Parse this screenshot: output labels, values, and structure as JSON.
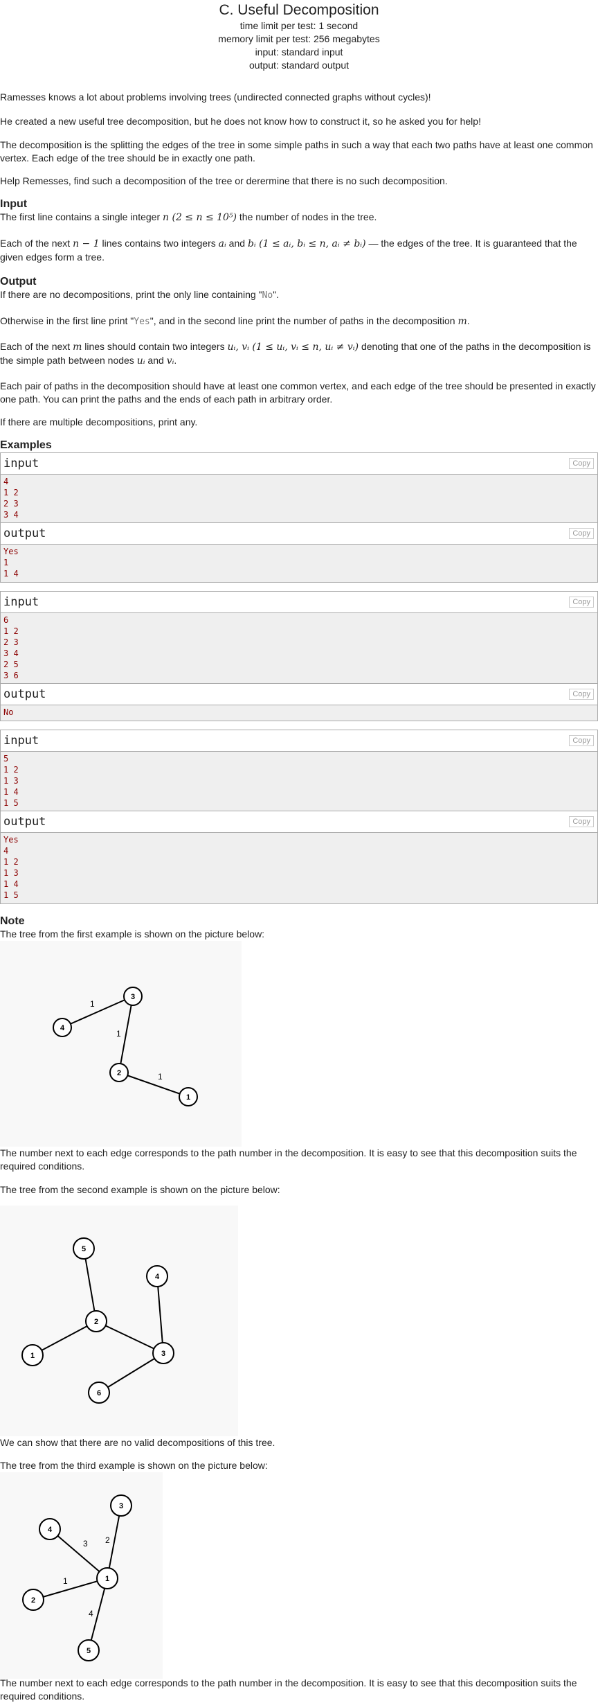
{
  "header": {
    "title": "C. Useful Decomposition",
    "time_limit": "time limit per test: 1 second",
    "memory_limit": "memory limit per test: 256 megabytes",
    "input": "input: standard input",
    "output": "output: standard output"
  },
  "legend": [
    "Ramesses knows a lot about problems involving trees (undirected connected graphs without cycles)!",
    "He created a new useful tree decomposition, but he does not know how to construct it, so he asked you for help!",
    "The decomposition is the splitting the edges of the tree in some simple paths in such a way that each two paths have at least one common vertex. Each edge of the tree should be in exactly one path.",
    "Help Remesses, find such a decomposition of the tree or derermine that there is no such decomposition."
  ],
  "input_spec": {
    "title": "Input",
    "line1_a": "The first line contains a single integer ",
    "line1_math": "n (2 ≤ n ≤ 10⁵)",
    "line1_b": " the number of nodes in the tree.",
    "line2_a": "Each of the next ",
    "line2_math1": "n − 1",
    "line2_b": " lines contains two integers ",
    "line2_math2": "aᵢ",
    "line2_c": " and ",
    "line2_math3": "bᵢ (1 ≤ aᵢ, bᵢ ≤ n, aᵢ ≠ bᵢ)",
    "line2_d": " — the edges of the tree. It is guaranteed that the given edges form a tree."
  },
  "output_spec": {
    "title": "Output",
    "p1_a": "If there are no decompositions, print the only line containing \"",
    "p1_code": "No",
    "p1_b": "\".",
    "p2_a": "Otherwise in the first line print \"",
    "p2_code": "Yes",
    "p2_b": "\", and in the second line print the number of paths in the decomposition ",
    "p2_math": "m",
    "p2_c": ".",
    "p3_a": "Each of the next ",
    "p3_math1": "m",
    "p3_b": " lines should contain two integers ",
    "p3_math2": "uᵢ, vᵢ (1 ≤ uᵢ, vᵢ ≤ n, uᵢ ≠ vᵢ)",
    "p3_c": " denoting that one of the paths in the decomposition is the simple path between nodes ",
    "p3_math3": "uᵢ",
    "p3_d": " and ",
    "p3_math4": "vᵢ",
    "p3_e": ".",
    "p4": "Each pair of paths in the decomposition should have at least one common vertex, and each edge of the tree should be presented in exactly one path. You can print the paths and the ends of each path in arbitrary order.",
    "p5": "If there are multiple decompositions, print any."
  },
  "examples": {
    "title": "Examples",
    "input_label": "input",
    "output_label": "output",
    "copy_label": "Copy",
    "tests": [
      {
        "input": "4\n1 2\n2 3\n3 4",
        "output": "Yes\n1\n1 4"
      },
      {
        "input": "6\n1 2\n2 3\n3 4\n2 5\n3 6",
        "output": "No"
      },
      {
        "input": "5\n1 2\n1 3\n1 4\n1 5",
        "output": "Yes\n4\n1 2\n1 3\n1 4\n1 5"
      }
    ]
  },
  "note": {
    "title": "Note",
    "fig1_caption": "The tree from the first example is shown on the picture below:",
    "fig1_after": "The number next to each edge corresponds to the path number in the decomposition. It is easy to see that this decomposition suits the required conditions.",
    "fig2_caption": "The tree from the second example is shown on the picture below:",
    "fig2_after": "We can show that there are no valid decompositions of this tree.",
    "fig3_caption": "The tree from the third example is shown on the picture below:",
    "fig3_after": "The number next to each edge corresponds to the path number in the decomposition. It is easy to see that this decomposition suits the required conditions."
  },
  "figures": [
    {
      "nodes": [
        "4",
        "3",
        "2",
        "1"
      ],
      "edge_labels": [
        "1",
        "1",
        "1"
      ]
    },
    {
      "nodes": [
        "5",
        "4",
        "2",
        "3",
        "1",
        "6"
      ]
    },
    {
      "nodes": [
        "4",
        "3",
        "1",
        "2",
        "5"
      ],
      "edge_labels": [
        "3",
        "2",
        "1",
        "4"
      ]
    }
  ]
}
